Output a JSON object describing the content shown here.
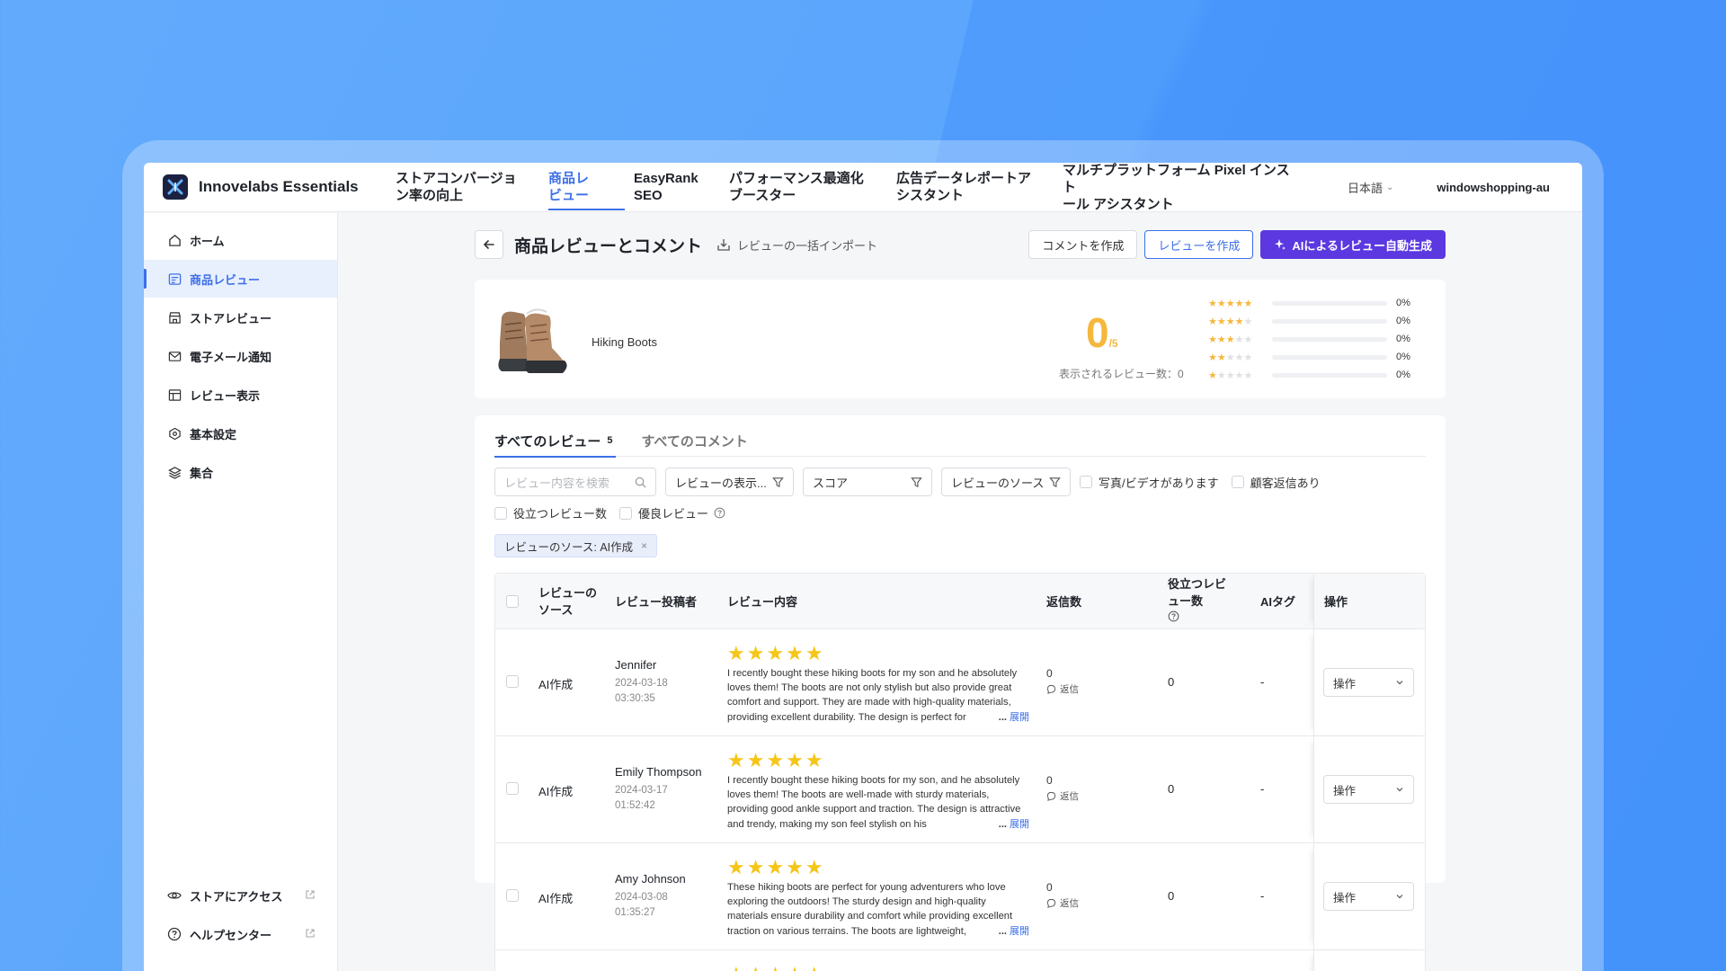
{
  "app": {
    "name": "Innovelabs Essentials"
  },
  "topnav": {
    "items": [
      {
        "label_l1": "ストアコンバージョ",
        "label_l2": "ン率の向上"
      },
      {
        "label_l1": "商品レ",
        "label_l2": "ビュー"
      },
      {
        "label_l1": "EasyRank",
        "label_l2": "SEO"
      },
      {
        "label_l1": "パフォーマンス最適化",
        "label_l2": "ブースター"
      },
      {
        "label_l1": "広告データレポートア",
        "label_l2": "シスタント"
      },
      {
        "label_l1": "マルチプラットフォーム Pixel インスト",
        "label_l2": "ール アシスタント"
      }
    ],
    "language": "日本語",
    "shop": "windowshopping-au"
  },
  "sidebar": {
    "items": [
      {
        "label": "ホーム",
        "icon": "home-icon"
      },
      {
        "label": "商品レビュー",
        "icon": "review-list-icon"
      },
      {
        "label": "ストアレビュー",
        "icon": "store-icon"
      },
      {
        "label": "電子メール通知",
        "icon": "mail-icon"
      },
      {
        "label": "レビュー表示",
        "icon": "layout-icon"
      },
      {
        "label": "基本設定",
        "icon": "settings-hex-icon"
      },
      {
        "label": "集合",
        "icon": "layers-icon"
      }
    ],
    "bottom": [
      {
        "label": "ストアにアクセス",
        "icon": "eye-icon"
      },
      {
        "label": "ヘルプセンター",
        "icon": "help-icon"
      }
    ]
  },
  "header": {
    "title": "商品レビューとコメント",
    "import": "レビューの一括インポート",
    "btn_comment": "コメントを作成",
    "btn_review": "レビューを作成",
    "btn_ai": "AIによるレビュー自動生成"
  },
  "product": {
    "name": "Hiking Boots",
    "score": "0",
    "score_den": "/5",
    "count_label": "表示されるレビュー数：0",
    "distribution": [
      {
        "stars": 5,
        "pct": "0%"
      },
      {
        "stars": 4,
        "pct": "0%"
      },
      {
        "stars": 3,
        "pct": "0%"
      },
      {
        "stars": 2,
        "pct": "0%"
      },
      {
        "stars": 1,
        "pct": "0%"
      }
    ]
  },
  "tabs": {
    "all_reviews": "すべてのレビュー",
    "all_reviews_count": "5",
    "all_comments": "すべてのコメント"
  },
  "filters": {
    "search_placeholder": "レビュー内容を検索",
    "display": "レビューの表示...",
    "score": "スコア",
    "source": "レビューのソース",
    "photo_video": "写真/ビデオがあります",
    "customer_reply": "顧客返信あり",
    "helpful": "役立つレビュー数",
    "excellent": "優良レビュー",
    "active_tag": "レビューのソース: AI作成"
  },
  "table": {
    "headers": {
      "source_l1": "レビューの",
      "source_l2": "ソース",
      "author": "レビュー投稿者",
      "content": "レビュー内容",
      "replies": "返信数",
      "helpful_l1": "役立つレビ",
      "helpful_l2": "ュー数",
      "ai_tag": "AIタグ",
      "ops": "操作"
    },
    "rows": [
      {
        "source": "AI作成",
        "author": "Jennifer",
        "date": "2024-03-18",
        "time": "03:30:35",
        "rating": 5,
        "content": "I recently bought these hiking boots for my son and he absolutely loves them! The boots are not only stylish but also provide great comfort and support. They are made with high-quality materials, providing excellent durability. The design is perfect for",
        "replies": "0",
        "reply_label": "返信",
        "helpful": "0",
        "ai_tag": "-",
        "op": "操作"
      },
      {
        "source": "AI作成",
        "author": "Emily Thompson",
        "date": "2024-03-17",
        "time": "01:52:42",
        "rating": 5,
        "content": "I recently bought these hiking boots for my son, and he absolutely loves them! The boots are well-made with sturdy materials, providing good ankle support and traction. The design is attractive and trendy, making my son feel stylish on his",
        "replies": "0",
        "reply_label": "返信",
        "helpful": "0",
        "ai_tag": "-",
        "op": "操作"
      },
      {
        "source": "AI作成",
        "author": "Amy Johnson",
        "date": "2024-03-08",
        "time": "01:35:27",
        "rating": 5,
        "content": "These hiking boots are perfect for young adventurers who love exploring the outdoors! The sturdy design and high-quality materials ensure durability and comfort while providing excellent traction on various terrains. The boots are lightweight,",
        "replies": "0",
        "reply_label": "返信",
        "helpful": "0",
        "ai_tag": "-",
        "op": "操作"
      }
    ],
    "expand_dots": "...",
    "expand_label": "展開"
  },
  "colors": {
    "accent": "#3d6fe8",
    "primary_button": "#5b38e0",
    "star": "#f5c518",
    "score": "#f5b83d"
  }
}
